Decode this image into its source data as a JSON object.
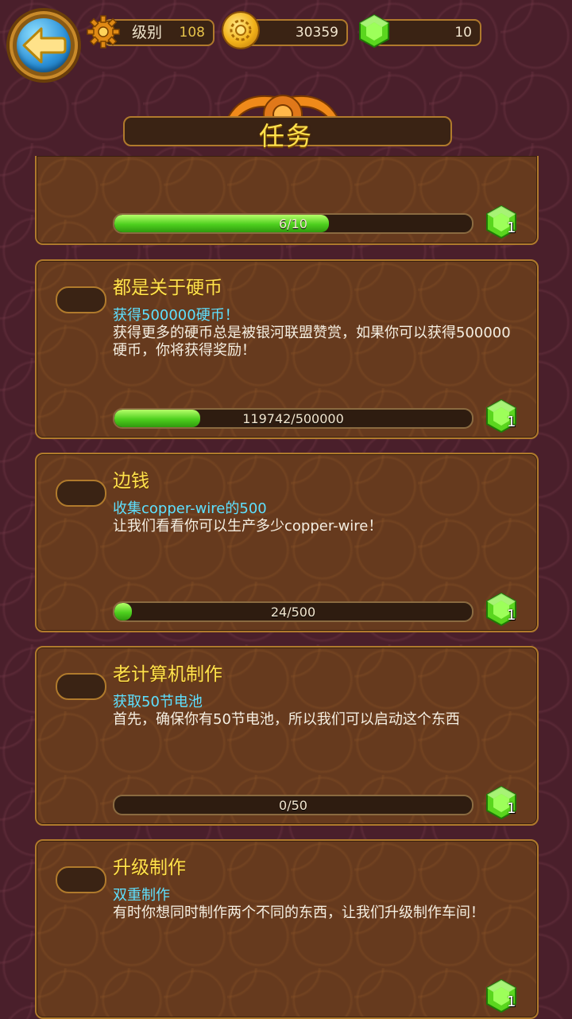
{
  "header": {
    "level_label": "级别",
    "level_value": "108",
    "coins": "30359",
    "gems": "10"
  },
  "title": "任务",
  "colors": {
    "title": "#ffe24d",
    "quest_title": "#ffe24d",
    "quest_goal": "#5ee0ff",
    "progress_fill": "#4dcf1e",
    "card_bg": "#663a1e",
    "card_border": "#b07a2c"
  },
  "quests": [
    {
      "progress_text": "6/10",
      "progress": 0.6,
      "reward": "1"
    },
    {
      "title": "都是关于硬币",
      "goal": "获得500000硬币！",
      "desc": "获得更多的硬币总是被银河联盟赞赏，如果你可以获得500000硬币，你将获得奖励！",
      "progress_text": "119742/500000",
      "progress": 0.239,
      "reward": "1"
    },
    {
      "title": "边钱",
      "goal": "收集copper-wire的500",
      "desc": "让我们看看你可以生产多少copper-wire！",
      "progress_text": "24/500",
      "progress": 0.048,
      "reward": "1"
    },
    {
      "title": "老计算机制作",
      "goal": "获取50节电池",
      "desc": "首先，确保你有50节电池，所以我们可以启动这个东西",
      "progress_text": "0/50",
      "progress": 0.0,
      "reward": "1"
    },
    {
      "title": "升级制作",
      "goal": "双重制作",
      "desc": "有时你想同时制作两个不同的东西，让我们升级制作车间！",
      "reward": "1"
    }
  ]
}
